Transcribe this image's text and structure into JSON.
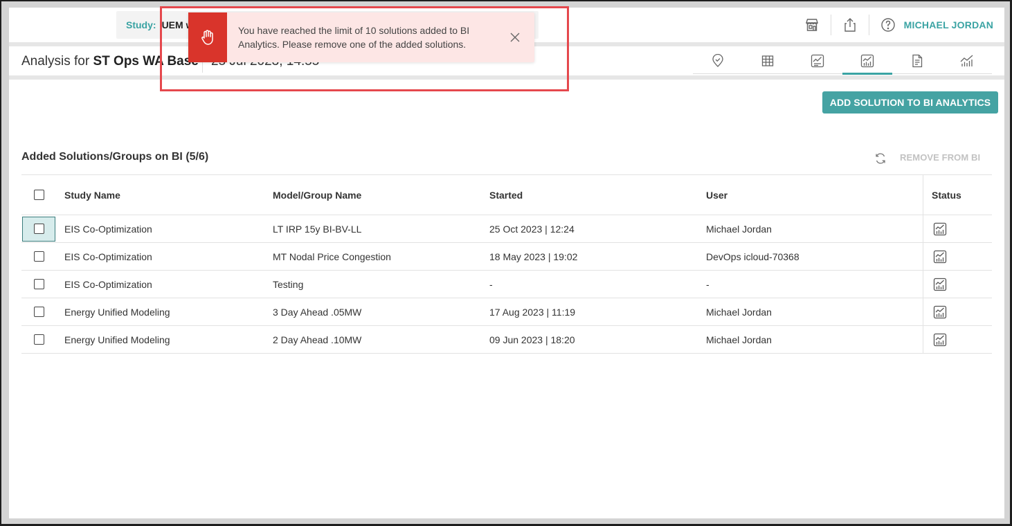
{
  "study": {
    "label": "Study:",
    "value": "UEM w"
  },
  "user": {
    "name": "MICHAEL JORDAN"
  },
  "topbar_icons": [
    "store-icon",
    "share-icon",
    "help-icon"
  ],
  "analysis": {
    "prefix": "Analysis for ",
    "name": "ST Ops WA Base",
    "date": "25 Jul 2023, 14:55"
  },
  "view_tabs": [
    {
      "icon": "location-pin-icon",
      "active": false
    },
    {
      "icon": "table-icon",
      "active": false
    },
    {
      "icon": "chart-report-icon",
      "active": false
    },
    {
      "icon": "bi-analytics-icon",
      "active": true
    },
    {
      "icon": "document-icon",
      "active": false
    },
    {
      "icon": "trend-chart-icon",
      "active": false
    }
  ],
  "actions": {
    "add_solution": "ADD SOLUTION TO BI ANALYTICS",
    "remove_from_bi": "REMOVE FROM BI"
  },
  "section": {
    "title": "Added Solutions/Groups on BI (5/6)"
  },
  "table": {
    "headers": {
      "study": "Study Name",
      "model": "Model/Group Name",
      "started": "Started",
      "user": "User",
      "status": "Status"
    },
    "rows": [
      {
        "study": "EIS Co-Optimization",
        "model": "LT IRP 15y BI-BV-LL",
        "started": "25 Oct 2023 | 12:24",
        "user": "Michael Jordan"
      },
      {
        "study": "EIS Co-Optimization",
        "model": "MT Nodal Price Congestion",
        "started": "18 May 2023 | 19:02",
        "user": "DevOps icloud-70368"
      },
      {
        "study": "EIS Co-Optimization",
        "model": "Testing",
        "started": "-",
        "user": "-"
      },
      {
        "study": "Energy Unified Modeling",
        "model": "3 Day Ahead .05MW",
        "started": "17 Aug 2023 | 11:19",
        "user": "Michael Jordan"
      },
      {
        "study": "Energy Unified Modeling",
        "model": "2 Day Ahead .10MW",
        "started": "09 Jun 2023 | 18:20",
        "user": "Michael Jordan"
      }
    ]
  },
  "toast": {
    "icon": "hand-stop-icon",
    "message": "You have reached the limit of 10 solutions added to BI Analytics. Please remove one of the added solutions."
  },
  "colors": {
    "accent": "#3aa3a3",
    "button": "#45a3a3",
    "toast_bg": "#fde6e5",
    "toast_icon": "#d9342b",
    "highlight": "#e5484d"
  }
}
